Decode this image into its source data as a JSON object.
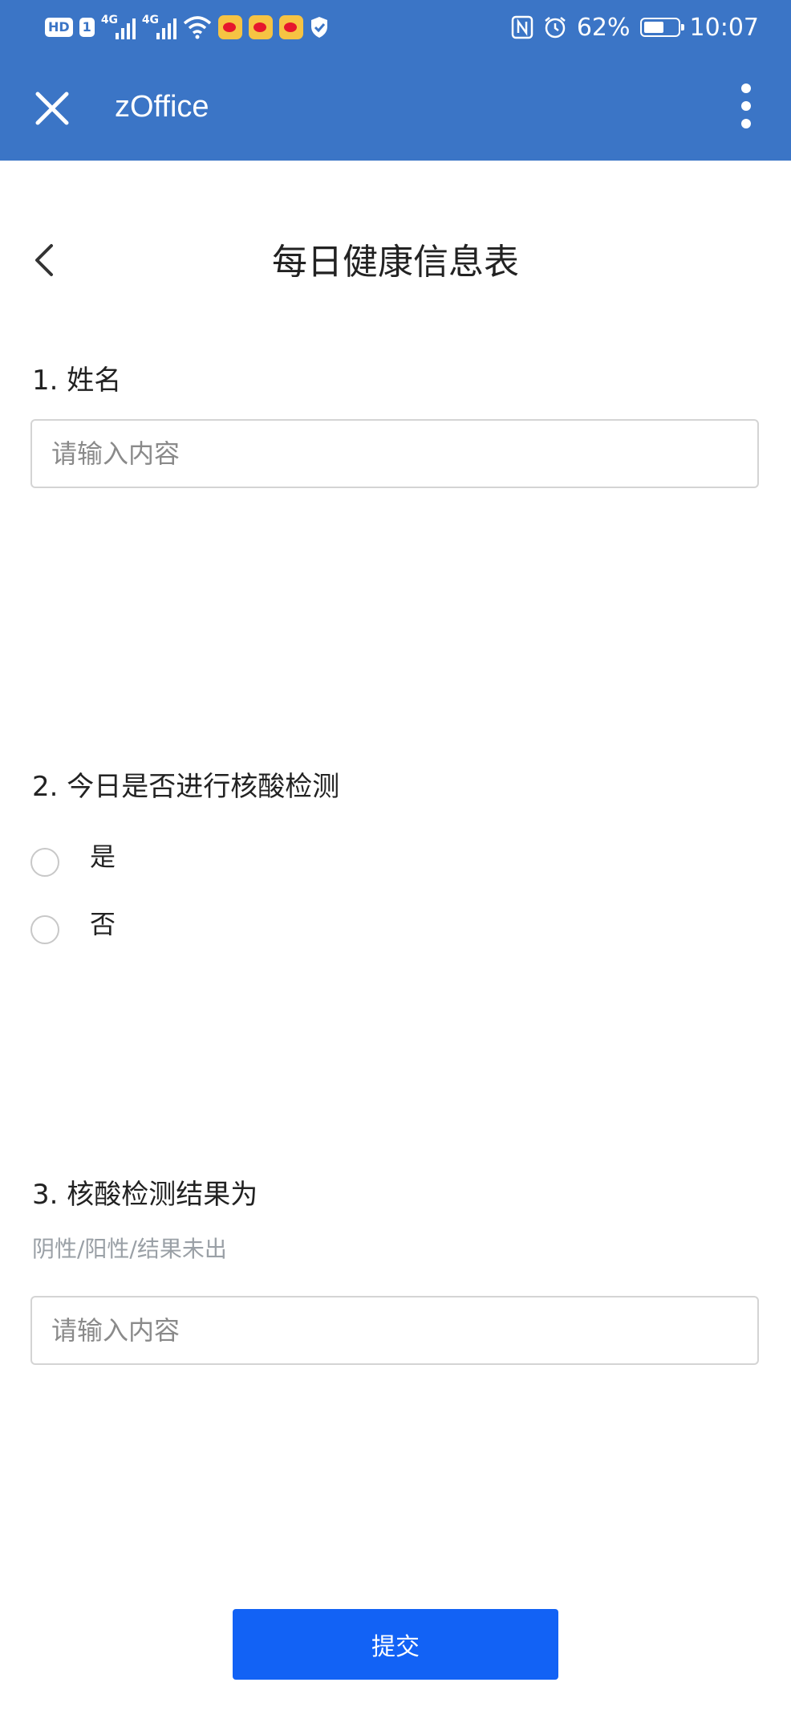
{
  "status_bar": {
    "left": {
      "hd": "HD",
      "sim1": "1",
      "net1": "4G",
      "net2": "4G"
    },
    "battery_percent": "62%",
    "battery_level": 0.62,
    "time": "10:07",
    "icons": [
      "signal-icon",
      "wifi-icon",
      "weibo-icon",
      "shield-icon",
      "nfc-icon",
      "alarm-icon",
      "battery-icon"
    ]
  },
  "app_bar": {
    "title": "zOffice",
    "close_icon": "close-icon",
    "more_icon": "more-vertical-icon",
    "background": "#3B75C6"
  },
  "form": {
    "title": "每日健康信息表",
    "questions": [
      {
        "label": "1. 姓名",
        "placeholder": "请输入内容",
        "value": ""
      },
      {
        "label": "2. 今日是否进行核酸检测",
        "options": [
          "是",
          "否"
        ],
        "selected": null
      },
      {
        "label": "3. 核酸检测结果为",
        "hint": "阴性/阳性/结果未出",
        "placeholder": "请输入内容",
        "value": ""
      }
    ],
    "submit_label": "提交",
    "submit_color": "#1262F5"
  }
}
